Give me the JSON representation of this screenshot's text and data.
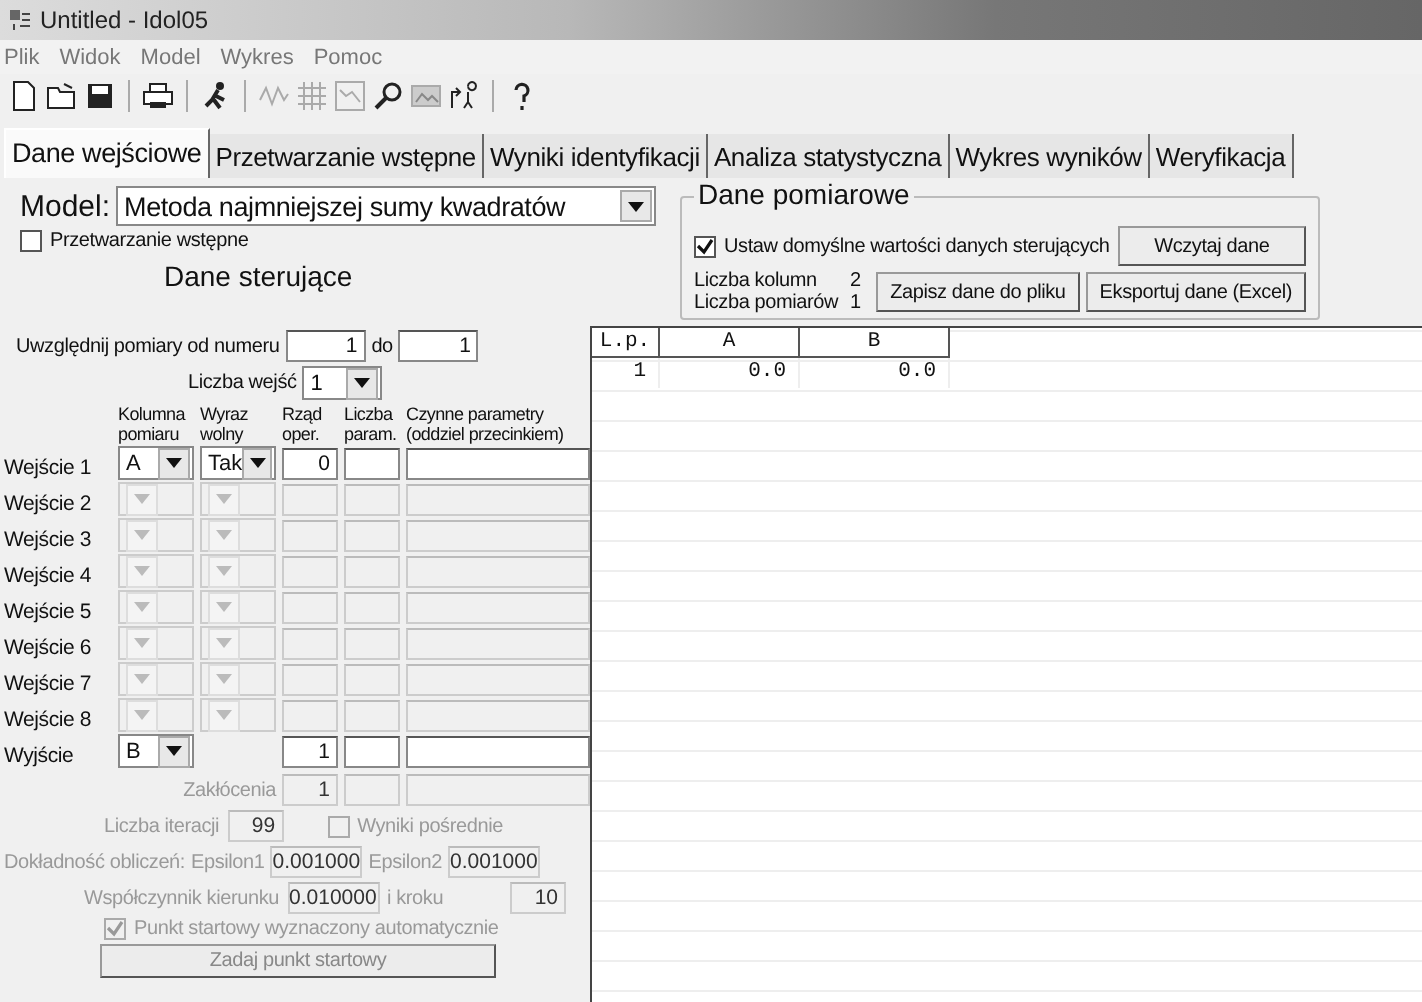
{
  "window": {
    "title": "Untitled - Idol05"
  },
  "menu": [
    "Plik",
    "Widok",
    "Model",
    "Wykres",
    "Pomoc"
  ],
  "toolbar": [
    {
      "kind": "new",
      "disabled": false
    },
    {
      "kind": "open",
      "disabled": false
    },
    {
      "kind": "save",
      "disabled": false
    },
    {
      "kind": "separator"
    },
    {
      "kind": "print",
      "disabled": false
    },
    {
      "kind": "separator"
    },
    {
      "kind": "runner",
      "disabled": false
    },
    {
      "kind": "separator"
    },
    {
      "kind": "wave",
      "disabled": true
    },
    {
      "kind": "grid",
      "disabled": true
    },
    {
      "kind": "chart",
      "disabled": true
    },
    {
      "kind": "zoom",
      "disabled": false
    },
    {
      "kind": "image",
      "disabled": true
    },
    {
      "kind": "arrow",
      "disabled": false
    },
    {
      "kind": "separator"
    },
    {
      "kind": "help",
      "disabled": false
    }
  ],
  "tabs": [
    {
      "label": "Dane wejściowe",
      "selected": true
    },
    {
      "label": "Przetwarzanie wstępne",
      "selected": false
    },
    {
      "label": "Wyniki identyfikacji",
      "selected": false
    },
    {
      "label": "Analiza statystyczna",
      "selected": false
    },
    {
      "label": "Wykres wyników",
      "selected": false
    },
    {
      "label": "Weryfikacja",
      "selected": false
    }
  ],
  "model": {
    "label": "Model:",
    "value": "Metoda najmniejszej sumy kwadratów"
  },
  "preprocessing": {
    "label": "Przetwarzanie wstępne",
    "checked": false
  },
  "measurement_data": {
    "title": "Dane pomiarowe",
    "default_checkbox": {
      "label": "Ustaw domyślne wartości danych sterujących",
      "checked": true
    },
    "columns": {
      "label": "Liczba kolumn",
      "value": "2"
    },
    "measurements": {
      "label": "Liczba pomiarów",
      "value": "1"
    },
    "load_button": "Wczytaj dane",
    "save_button": "Zapisz dane do pliku",
    "export_button": "Eksportuj dane (Excel)"
  },
  "control_data": {
    "title": "Dane sterujące",
    "range": {
      "label": "Uwzględnij  pomiary od numeru",
      "from": "1",
      "to_label": "do",
      "to": "1"
    },
    "input_count": {
      "label": "Liczba wejść",
      "value": "1"
    },
    "columns": [
      "Kolumna pomiaru",
      "Wyraz wolny",
      "Rząd oper.",
      "Liczba param.",
      "Czynne parametry (oddziel przecinkiem)"
    ]
  },
  "inputs": [
    {
      "label": "Wejście 1",
      "column": "A",
      "intercept": "Tak",
      "order": "0",
      "disabled": false
    },
    {
      "label": "Wejście 2",
      "disabled": true
    },
    {
      "label": "Wejście 3",
      "disabled": true
    },
    {
      "label": "Wejście 4",
      "disabled": true
    },
    {
      "label": "Wejście 5",
      "disabled": true
    },
    {
      "label": "Wejście 6",
      "disabled": true
    },
    {
      "label": "Wejście 7",
      "disabled": true
    },
    {
      "label": "Wejście 8",
      "disabled": true
    }
  ],
  "output": {
    "label": "Wyjście",
    "column": "B",
    "order": "1"
  },
  "noise": {
    "label": "Zakłócenia",
    "value": "1",
    "disabled": true
  },
  "iterations": {
    "label": "Liczba iteracji",
    "value": "99",
    "disabled": true
  },
  "intermediate": {
    "label": "Wyniki pośrednie",
    "checked": false,
    "disabled": true
  },
  "precision": {
    "label": "Dokładność obliczeń:",
    "eps1_label": "Epsilon1",
    "eps1": "0.001000",
    "eps2_label": "Epsilon2",
    "eps2": "0.001000",
    "disabled": true
  },
  "direction": {
    "label": "Współczynnik kierunku",
    "value": "0.010000",
    "step_label": "i kroku",
    "step": "10",
    "disabled": true
  },
  "auto_start": {
    "label": "Punkt startowy wyznaczony automatycznie",
    "checked": true,
    "disabled": true
  },
  "start_button": {
    "label": "Zadaj punkt startowy",
    "disabled": true
  },
  "table": {
    "columns": [
      "L.p.",
      "A",
      "B"
    ],
    "rows": [
      [
        "1",
        "0.0",
        "0.0"
      ]
    ]
  }
}
